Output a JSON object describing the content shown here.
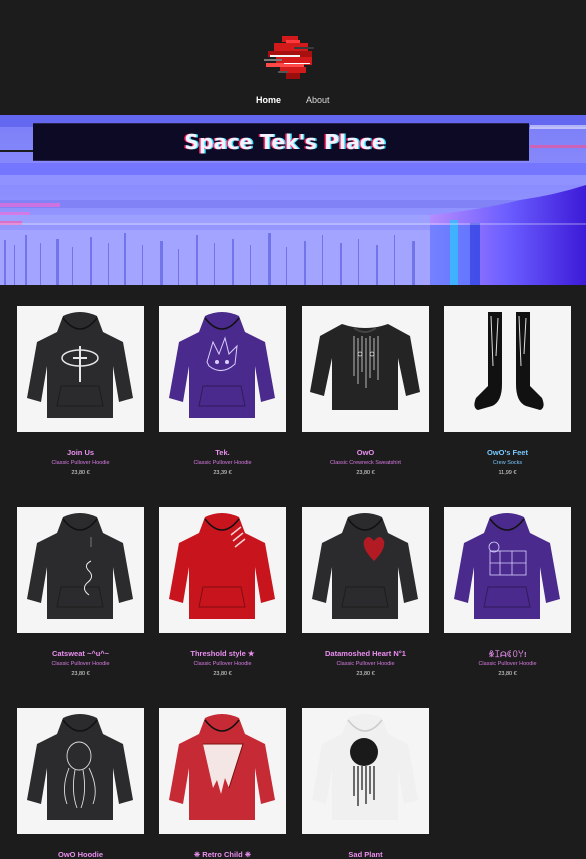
{
  "nav": {
    "home": "Home",
    "about": "About"
  },
  "banner": {
    "title": "Space Tek's Place"
  },
  "colors": {
    "background": "#1c1c1c",
    "accent_pink": "#ea8ff0",
    "accent_blue": "#78c8ff",
    "banner_blue": "#8a8cff"
  },
  "products": [
    {
      "name": "Join Us",
      "type": "Classic Pullover Hoodie",
      "price": "23,80 €",
      "color": "#2b2b2d",
      "kind": "hoodie",
      "icon": "eye-cross-icon"
    },
    {
      "name": "Tek.",
      "type": "Classic Pullover Hoodie",
      "price": "23,39 €",
      "color": "#4a2a8c",
      "kind": "hoodie",
      "icon": "anime-face-icon"
    },
    {
      "name": "OwO",
      "type": "Classic Crewneck Sweatshirt",
      "price": "23,80 €",
      "color": "#242424",
      "kind": "sweatshirt",
      "icon": "drip-face-icon"
    },
    {
      "name": "OwO's Feet",
      "type": "Crew Socks",
      "price": "11,99 €",
      "color": "#111111",
      "kind": "socks",
      "icon": "socks-icon",
      "highlight": "blue"
    },
    {
      "name": "Catsweat ~^u^~",
      "type": "Classic Pullover Hoodie",
      "price": "23,80 €",
      "color": "#2b2b2d",
      "kind": "hoodie",
      "icon": "squiggle-icon"
    },
    {
      "name": "Threshold style ★",
      "type": "Classic Pullover Hoodie",
      "price": "23,80 €",
      "color": "#c8141c",
      "kind": "hoodie",
      "icon": "slash-icon"
    },
    {
      "name": "Datamoshed Heart N°1",
      "type": "Classic Pullover Hoodie",
      "price": "23,80 €",
      "color": "#2b2b2d",
      "kind": "hoodie",
      "icon": "heart-icon"
    },
    {
      "name": "ꆜꀤᗩꀯꄲꌩ!",
      "type": "Classic Pullover Hoodie",
      "price": "23,80 €",
      "color": "#4a2a8c",
      "kind": "hoodie",
      "icon": "glitch-art-icon"
    },
    {
      "name": "OwO Hoodie",
      "type": "",
      "price": "",
      "color": "#2b2b2d",
      "kind": "hoodie-back",
      "icon": "octopus-icon"
    },
    {
      "name": "❈ Retro Child ❈",
      "type": "",
      "price": "",
      "color": "#c52a35",
      "kind": "hoodie-back",
      "icon": "triangle-drip-icon"
    },
    {
      "name": "Sad Plant",
      "type": "",
      "price": "",
      "color": "#f0f0f0",
      "kind": "hoodie-back",
      "icon": "plant-drip-icon"
    }
  ]
}
